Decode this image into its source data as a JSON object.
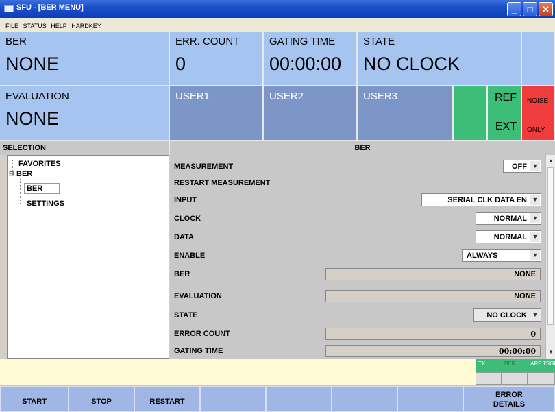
{
  "window": {
    "title": "SFU - [BER MENU]",
    "min_glyph": "_",
    "max_glyph": "□",
    "close_glyph": "✕"
  },
  "menu": [
    "FILE",
    "STATUS",
    "HELP",
    "HARDKEY"
  ],
  "tiles": {
    "ber": {
      "label": "BER",
      "value": "NONE"
    },
    "err_count": {
      "label": "ERR. COUNT",
      "value": "0"
    },
    "gating_time": {
      "label": "GATING TIME",
      "value": "00:00:00"
    },
    "state": {
      "label": "STATE",
      "value": "NO CLOCK"
    },
    "evaluation": {
      "label": "EVALUATION",
      "value": "NONE"
    },
    "user1": {
      "label": "USER1"
    },
    "user2": {
      "label": "USER2"
    },
    "user3": {
      "label": "USER3"
    },
    "ref": {
      "label": "REF",
      "value": "EXT"
    },
    "noise": {
      "label": "NOISE",
      "value": "ONLY"
    }
  },
  "colors": {
    "tile_blue": "#a6c4f0",
    "user_tile": "#7c96c8",
    "ok_green": "#3cbe78",
    "alert_red": "#f03c3c"
  },
  "selection_header": "SELECTION",
  "panel_header": "BER",
  "tree": {
    "favorites": "FAVORITES",
    "ber_group": "BER",
    "ber_item": "BER",
    "settings_item": "SETTINGS",
    "expand_glyph": "⊟"
  },
  "params": {
    "measurement": {
      "label": "MEASUREMENT",
      "value": "OFF"
    },
    "restart": {
      "label": "RESTART MEASUREMENT"
    },
    "input": {
      "label": "INPUT",
      "value": "SERIAL CLK DATA EN"
    },
    "clock": {
      "label": "CLOCK",
      "value": "NORMAL"
    },
    "data": {
      "label": "DATA",
      "value": "NORMAL"
    },
    "enable": {
      "label": "ENABLE",
      "value": "ALWAYS"
    },
    "ber": {
      "label": "BER",
      "value": "NONE"
    },
    "evaluation": {
      "label": "EVALUATION",
      "value": "NONE"
    },
    "state": {
      "label": "STATE",
      "value": "NO CLOCK"
    },
    "error_count": {
      "label": "ERROR COUNT",
      "value": "0"
    },
    "gating_time": {
      "label": "GATING TIME",
      "value": "00:00:00"
    }
  },
  "modes": [
    "TX",
    "BER",
    "ARB",
    "TSGEN"
  ],
  "softkeys": {
    "start": "START",
    "stop": "STOP",
    "restart": "RESTART",
    "error_details_1": "ERROR",
    "error_details_2": "DETAILS"
  }
}
